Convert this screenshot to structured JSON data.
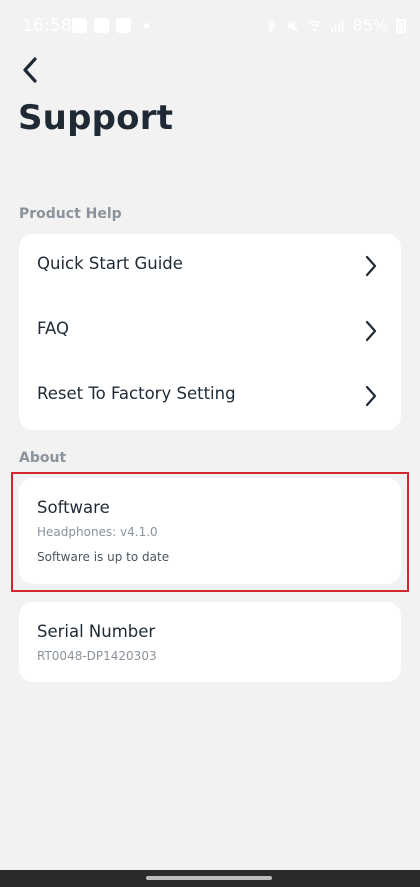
{
  "status_bar": {
    "time": "16:58",
    "battery": "85%"
  },
  "header": {
    "title": "Support"
  },
  "sections": {
    "product_help": {
      "label": "Product Help",
      "items": [
        {
          "label": "Quick Start Guide"
        },
        {
          "label": "FAQ"
        },
        {
          "label": "Reset To Factory Setting"
        }
      ]
    },
    "about": {
      "label": "About",
      "software": {
        "title": "Software",
        "version": "Headphones: v4.1.0",
        "status": "Software is up to date"
      },
      "serial": {
        "title": "Serial Number",
        "value": "RT0048-DP1420303"
      }
    }
  },
  "icons": {
    "back": "back-arrow-icon",
    "chevron": "chevron-right-icon"
  },
  "colors": {
    "background": "#f2f2f2",
    "card": "#ffffff",
    "title_text": "#1f2a35",
    "muted_text": "#8a939c",
    "highlight": "#d3262f"
  }
}
